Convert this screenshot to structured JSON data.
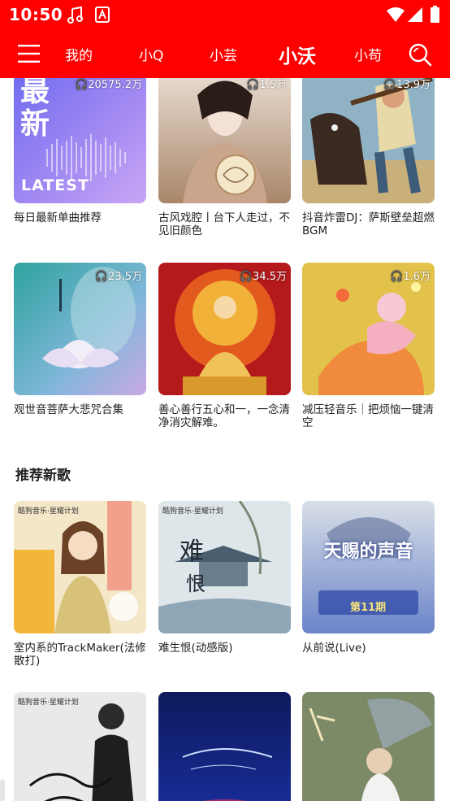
{
  "status_bar": {
    "time": "10:50",
    "icons": [
      "music-note-icon",
      "app-notification-icon",
      "wifi-icon",
      "cell-signal-icon",
      "battery-icon"
    ]
  },
  "nav": {
    "menu_icon": "menu-icon",
    "search_icon": "search-icon",
    "tabs": [
      {
        "label": "我的",
        "active": false
      },
      {
        "label": "小Q",
        "active": false
      },
      {
        "label": "小芸",
        "active": false
      },
      {
        "label": "小沃",
        "active": true
      },
      {
        "label": "小苟",
        "active": false
      }
    ]
  },
  "playlists": [
    {
      "count": "20575.2万",
      "title": "每日最新单曲推荐",
      "cover_text": [
        "最",
        "新",
        "LATEST"
      ]
    },
    {
      "count": "1.5万",
      "title": "古风戏腔丨台下人走过，不见旧颜色"
    },
    {
      "count": "13.9万",
      "title": "抖音炸雷DJ：萨斯壁垒超燃BGM"
    },
    {
      "count": "23.5万",
      "title": "观世音菩萨大悲咒合集"
    },
    {
      "count": "34.5万",
      "title": "善心善行五心和一，一念清净消灾解难。"
    },
    {
      "count": "1.6万",
      "title": "减压轻音乐｜把烦恼一键清空"
    }
  ],
  "new_songs_section": {
    "title": "推荐新歌",
    "songs": [
      {
        "title": "室内系的TrackMaker(法修散打)",
        "cover_text": "酷狗音乐·星耀计划"
      },
      {
        "title": "难生恨(动感版)",
        "cover_text": "酷狗音乐·星耀计划"
      },
      {
        "title": "从前说(Live)",
        "cover_text": "天赐的声音"
      },
      {
        "title": "",
        "cover_text": "酷狗音乐·星耀计划"
      },
      {
        "title": "",
        "cover_text": ""
      },
      {
        "title": "",
        "cover_text": ""
      }
    ]
  },
  "colors": {
    "brand_red": "#ff0000",
    "text_primary": "#222222",
    "background": "#ffffff"
  }
}
